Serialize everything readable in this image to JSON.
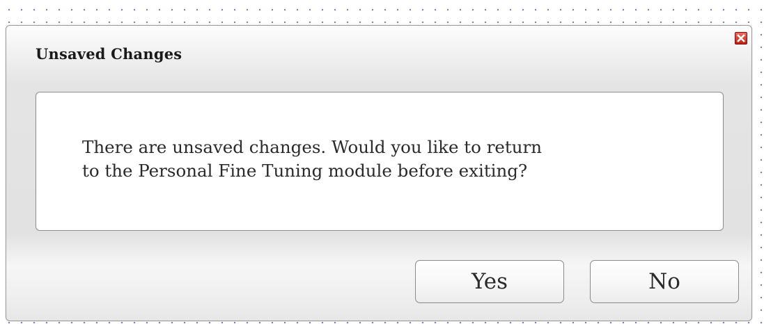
{
  "dialog": {
    "title": "Unsaved Changes",
    "close_icon": "close-icon",
    "message_line_1": "There are unsaved changes. Would you like to return",
    "message_line_2": "to the Personal Fine Tuning module before exiting?",
    "buttons": {
      "yes_label": "Yes",
      "no_label": "No"
    }
  },
  "colors": {
    "close_button": "#d3281c",
    "background_dots": "#7b7bd6"
  }
}
